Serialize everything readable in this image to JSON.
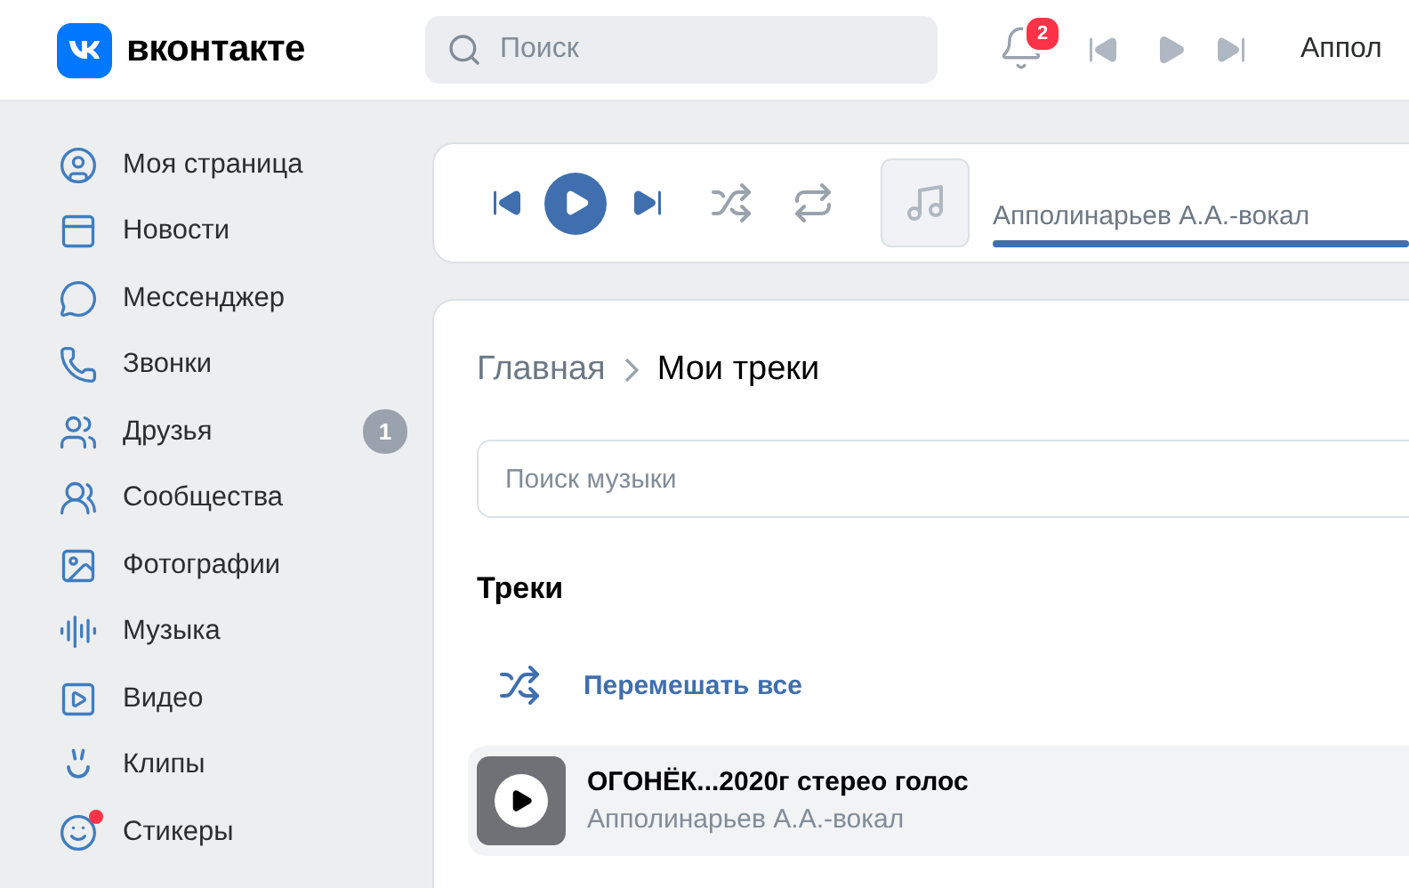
{
  "header": {
    "logo_text": "вконтакте",
    "search": {
      "placeholder": "Поиск"
    },
    "notifications_count": "2",
    "now_playing": "Аппол"
  },
  "sidebar": {
    "items": [
      {
        "label": "Моя страница",
        "dot": false
      },
      {
        "label": "Новости",
        "dot": false
      },
      {
        "label": "Мессенджер",
        "dot": false
      },
      {
        "label": "Звонки",
        "dot": false
      },
      {
        "label": "Друзья",
        "badge": "1",
        "dot": false
      },
      {
        "label": "Сообщества",
        "dot": false
      },
      {
        "label": "Фотографии",
        "dot": false
      },
      {
        "label": "Музыка",
        "dot": false
      },
      {
        "label": "Видео",
        "dot": false
      },
      {
        "label": "Клипы",
        "dot": false
      },
      {
        "label": "Стикеры",
        "dot": true
      }
    ]
  },
  "player": {
    "playing": false,
    "artist": "Апполинарьев А.А.-вокал",
    "level": 1
  },
  "breadcrumbs": [
    {
      "label": "Главная"
    },
    {
      "label": "Мои треки"
    }
  ],
  "music_search": {
    "placeholder": "Поиск музыки"
  },
  "section_title": "Треки",
  "shuffle_all": "Перемешать все",
  "tracks": [
    {
      "title": "ОГОНЁК...2020г стерео голос",
      "artist": "Апполинарьев А.А.-вокал",
      "hovered": true
    }
  ]
}
